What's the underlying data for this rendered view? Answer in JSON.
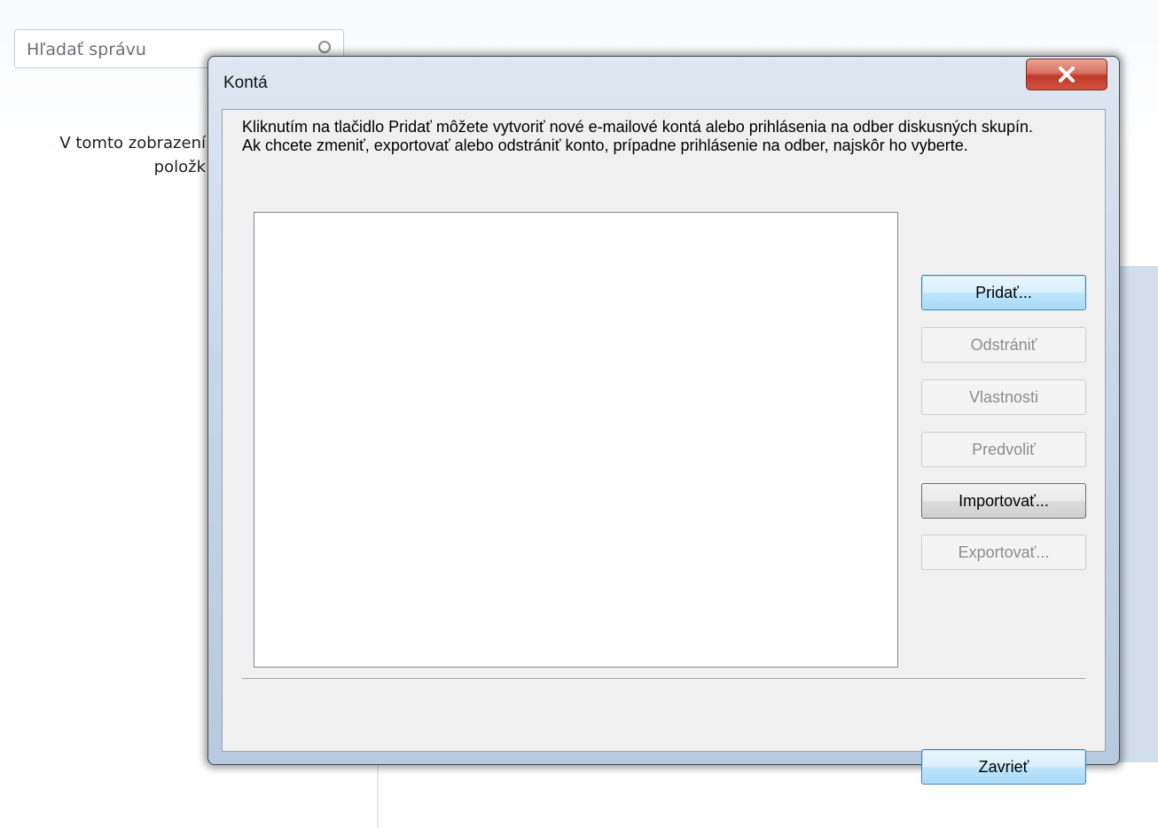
{
  "background": {
    "search": {
      "placeholder": "Hľadať správu",
      "icon": "search-icon"
    },
    "empty_message_lines": [
      "V tomto zobrazení",
      "položk"
    ]
  },
  "dialog": {
    "title": "Kontá",
    "close_icon": "close-icon",
    "instructions": [
      "Kliknutím na tlačidlo Pridať môžete vytvoriť nové e-mailové kontá alebo prihlásenia na odber diskusných skupín.",
      "Ak chcete zmeniť, exportovať alebo odstrániť konto, prípadne prihlásenie na odber, najskôr ho vyberte."
    ],
    "buttons": {
      "add": "Pridať...",
      "remove": "Odstrániť",
      "properties": "Vlastnosti",
      "set_default": "Predvoliť",
      "import": "Importovať...",
      "export": "Exportovať...",
      "close": "Zavrieť"
    },
    "colors": {
      "close_button": "#c7402e",
      "focus_border": "#3c7fb1"
    }
  }
}
